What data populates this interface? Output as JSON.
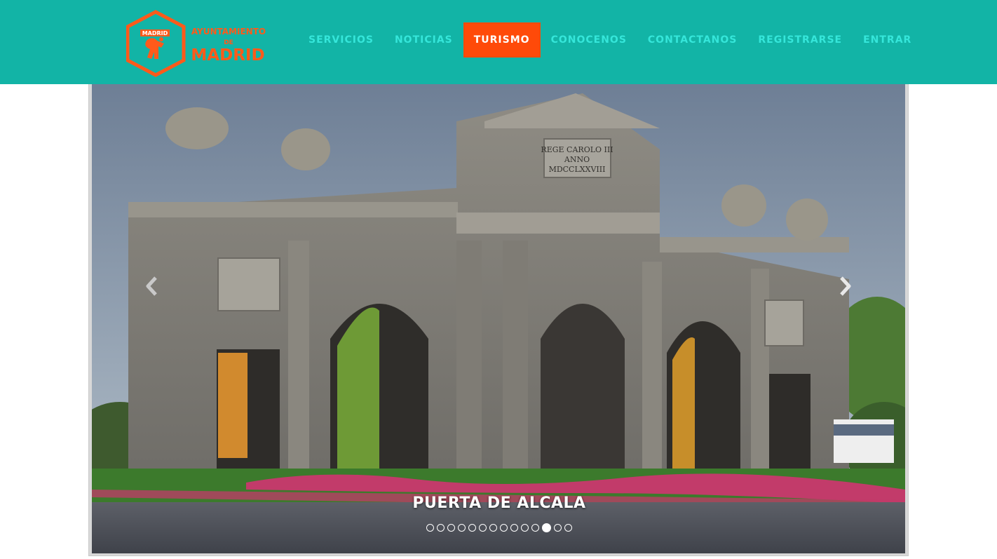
{
  "header": {
    "logo": {
      "top_text": "MADRID",
      "line1": "AYUNTAMIENTO",
      "line2": "DE",
      "line3": "MADRID",
      "color": "#ff5a1a"
    },
    "nav": [
      {
        "label": "SERVICIOS",
        "active": false
      },
      {
        "label": "NOTICIAS",
        "active": false
      },
      {
        "label": "TURISMO",
        "active": true
      },
      {
        "label": "CONOCENOS",
        "active": false
      },
      {
        "label": "CONTACTANOS",
        "active": false
      },
      {
        "label": "REGISTRARSE",
        "active": false
      },
      {
        "label": "ENTRAR",
        "active": false
      }
    ],
    "background_color": "#12b4a6",
    "active_color": "#ff4a09",
    "link_color": "#35e6da"
  },
  "carousel": {
    "caption": "PUERTA DE ALCALA",
    "inscription": [
      "REGE CAROLO III",
      "ANNO",
      "MDCCLXXVIII"
    ],
    "slide_count": 14,
    "active_index": 11,
    "prev_icon": "chevron-left-icon",
    "next_icon": "chevron-right-icon"
  }
}
